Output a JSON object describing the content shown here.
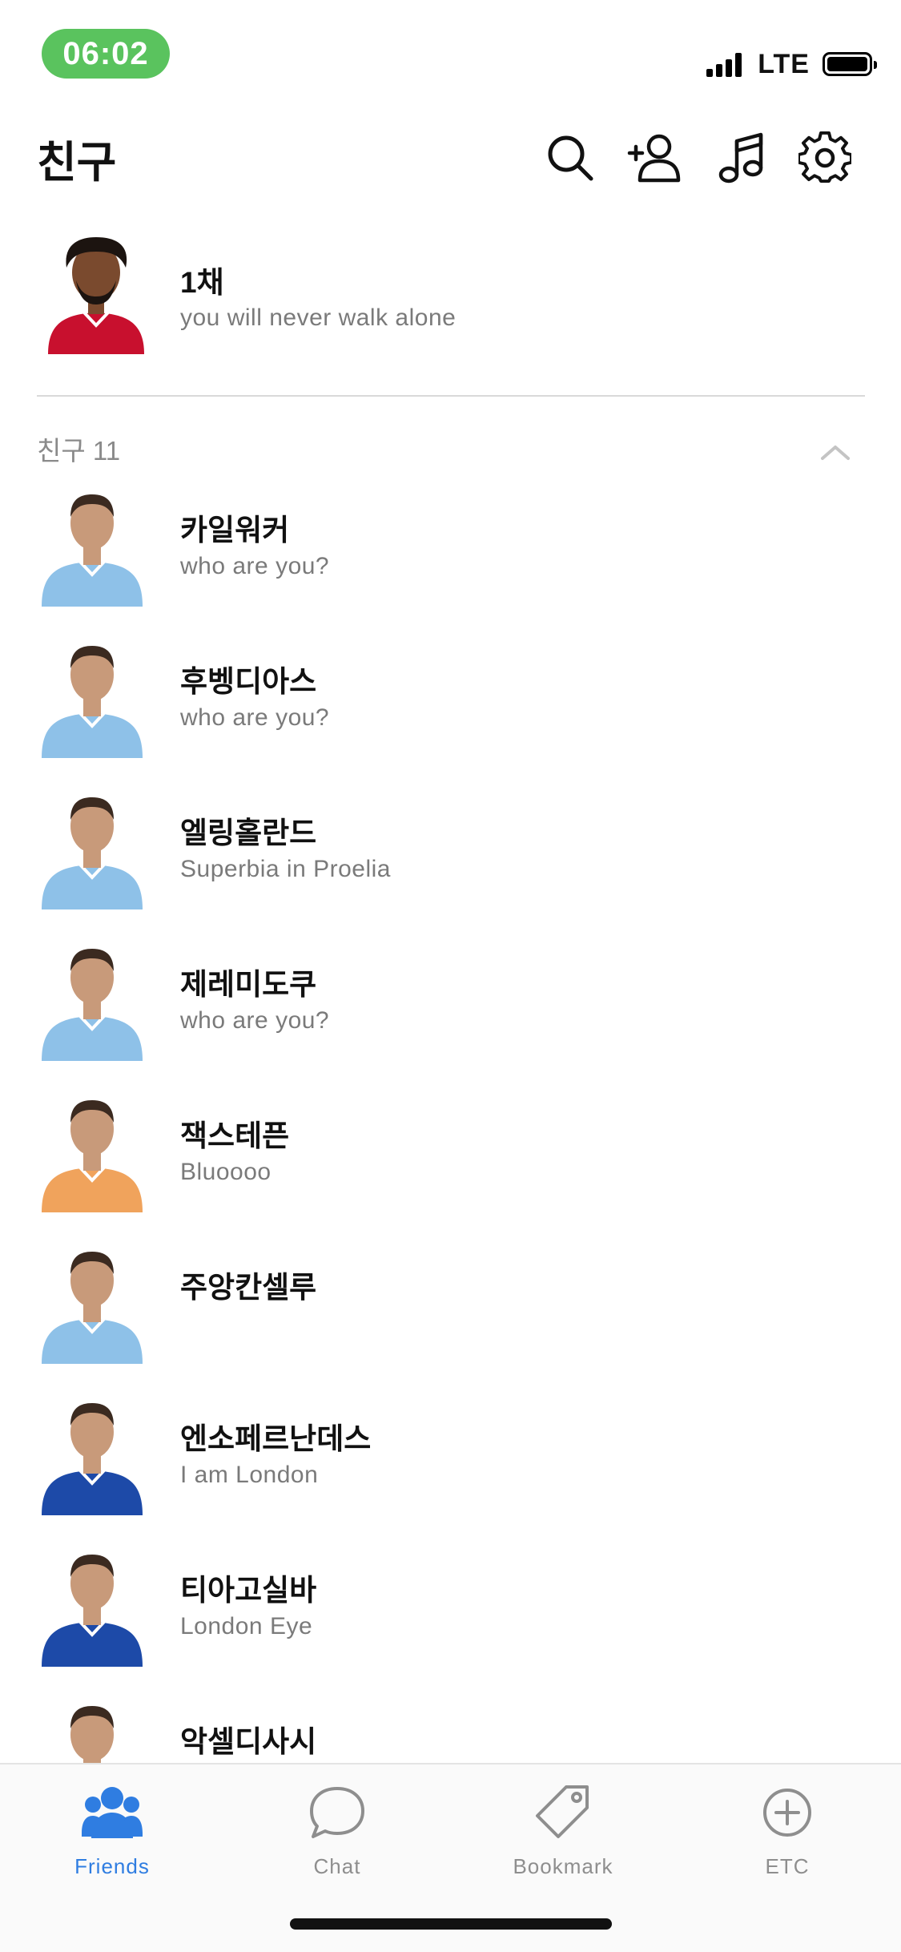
{
  "status_bar": {
    "time": "06:02",
    "network": "LTE"
  },
  "header": {
    "title": "친구"
  },
  "my_profile": {
    "name": "1채",
    "status": "you will never walk alone"
  },
  "friends_section": {
    "label": "친구 11"
  },
  "friends": [
    {
      "name": "카일워커",
      "status": "who are you?",
      "jersey": "#8ec1e8"
    },
    {
      "name": "후벵디아스",
      "status": "who are you?",
      "jersey": "#8ec1e8"
    },
    {
      "name": "엘링홀란드",
      "status": "Superbia in Proelia",
      "jersey": "#8ec1e8"
    },
    {
      "name": "제레미도쿠",
      "status": "who are you?",
      "jersey": "#8ec1e8"
    },
    {
      "name": "잭스테픈",
      "status": "Bluoooo",
      "jersey": "#f0a35c"
    },
    {
      "name": "주앙칸셀루",
      "status": "",
      "jersey": "#8ec1e8"
    },
    {
      "name": "엔소페르난데스",
      "status": "I am London",
      "jersey": "#1d4aa8"
    },
    {
      "name": "티아고실바",
      "status": "London Eye",
      "jersey": "#1d4aa8"
    },
    {
      "name": "악셀디사시",
      "status": "",
      "jersey": "#1d4aa8"
    }
  ],
  "tabs": [
    {
      "label": "Friends",
      "icon": "people-icon",
      "active": true
    },
    {
      "label": "Chat",
      "icon": "chat-bubble-icon",
      "active": false
    },
    {
      "label": "Bookmark",
      "icon": "tag-icon",
      "active": false
    },
    {
      "label": "ETC",
      "icon": "plus-circle-icon",
      "active": false
    }
  ],
  "colors": {
    "accent": "#2f7de1",
    "time_pill": "#5ac35e",
    "liverpool_red": "#c8102e"
  }
}
